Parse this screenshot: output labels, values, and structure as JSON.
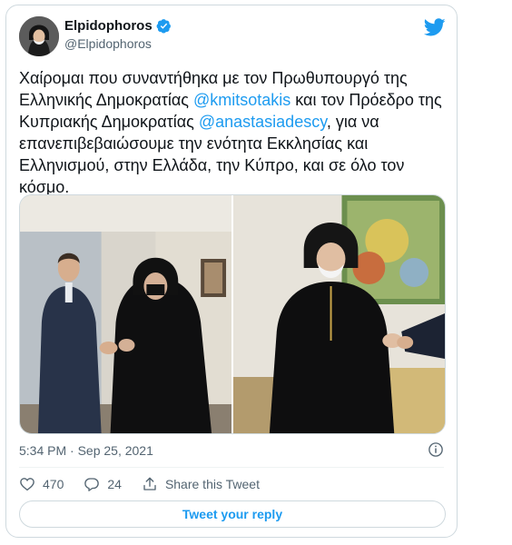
{
  "author": {
    "name": "Elpidophoros",
    "handle": "@Elpidophoros",
    "verified": true,
    "avatar_icon": "avatar-photo"
  },
  "tweet": {
    "text_part1": "Χαίρομαι που συναντήθηκα με τον Πρωθυπουργό της Ελληνικής Δημοκρατίας ",
    "mention1": "@kmitsotakis",
    "text_part2": " και τον Πρόεδρο της Κυπριακής Δημοκρατίας ",
    "mention2": "@anastasiadescy",
    "text_part3": ", για να επανεπιβεβαιώσουμε την ενότητα Εκκλησίας και Ελληνισμού, στην Ελλάδα, την Κύπρο, και σε όλο τον κόσμο.",
    "timestamp": "5:34 PM · Sep 25, 2021"
  },
  "actions": {
    "likes": "470",
    "replies": "24",
    "share_label": "Share this Tweet"
  },
  "reply_button": "Tweet your reply",
  "colors": {
    "accent": "#1d9bf0",
    "muted": "#536471",
    "border": "#cfd9de"
  }
}
